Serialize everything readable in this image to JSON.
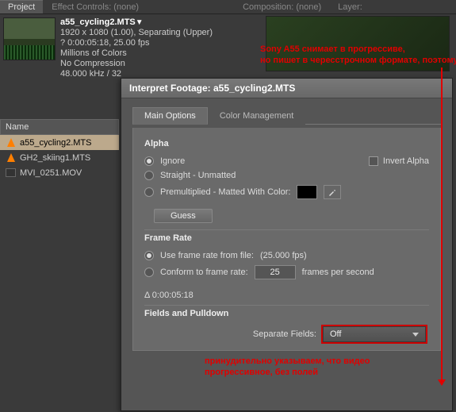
{
  "panels": {
    "project": "Project",
    "effect": "Effect Controls: (none)",
    "comp": "Composition: (none)",
    "layer": "Layer:"
  },
  "clip": {
    "name": "a55_cycling2.MTS",
    "dims": "1920 x 1080 (1.00), Separating (Upper)",
    "dur": "? 0:00:05:18, 25.00 fps",
    "colors": "Millions of Colors",
    "codec": "No Compression",
    "audio": "48.000 kHz / 32"
  },
  "filelist": {
    "header": "Name",
    "items": [
      "a55_cycling2.MTS",
      "GH2_skiing1.MTS",
      "MVI_0251.MOV"
    ]
  },
  "dialog": {
    "title": "Interpret Footage: a55_cycling2.MTS",
    "tabs": {
      "main": "Main Options",
      "color": "Color Management"
    },
    "alpha": {
      "title": "Alpha",
      "ignore": "Ignore",
      "invert": "Invert Alpha",
      "straight": "Straight - Unmatted",
      "premul": "Premultiplied - Matted With Color:",
      "guess": "Guess"
    },
    "framerate": {
      "title": "Frame Rate",
      "usefile": "Use frame rate from file:",
      "usefile_val": "(25.000 fps)",
      "conform": "Conform to frame rate:",
      "conform_val": "25",
      "conform_unit": "frames per second",
      "delta": "Δ 0:00:05:18"
    },
    "fields": {
      "title": "Fields and Pulldown",
      "sep_label": "Separate Fields:",
      "sep_value": "Off"
    }
  },
  "annotations": {
    "top": "Sony A55 снимает в прогрессиве,\nно пишет в чересстрочном формате, поэтому",
    "bottom": "принудительно указываем, что видео\nпрогрессивное, без полей"
  }
}
